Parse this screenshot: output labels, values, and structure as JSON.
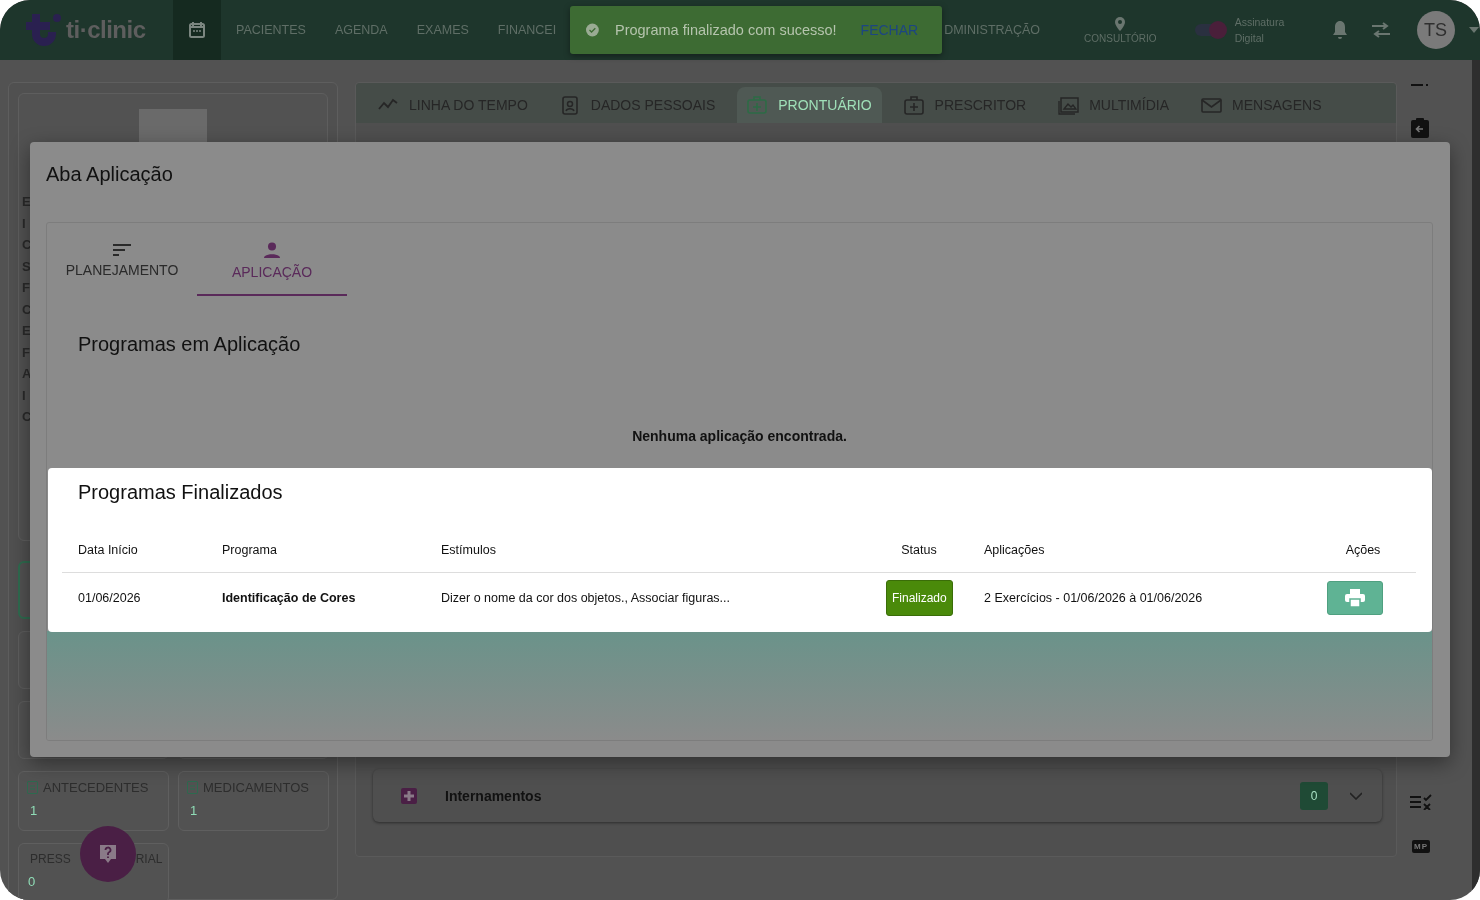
{
  "header": {
    "logo": "ti·clinic",
    "nav": [
      {
        "label": "PACIENTES"
      },
      {
        "label": "AGENDA"
      },
      {
        "label": "EXAMES"
      },
      {
        "label": "FINANCEI"
      },
      {
        "label": "DMINISTRAÇÃO"
      }
    ],
    "location_label": "CONSULTÓRIO",
    "signature_toggle": {
      "label": "Assinatura Digital",
      "on": true
    },
    "avatar_initials": "TS"
  },
  "toast": {
    "message": "Programa finalizado com sucesso!",
    "action": "FECHAR"
  },
  "patient_sidebar": {
    "info_fragments": [
      "E",
      "I",
      "C",
      "S",
      "F",
      "C",
      "E",
      "F",
      "A",
      "I",
      "C"
    ],
    "cards": [
      {
        "label_parts": [
          "ANTECEDENTES"
        ],
        "count": "1"
      },
      {
        "label_parts": [
          "MEDICAMENTOS"
        ],
        "count": "1"
      },
      {
        "label_parts": [
          "PRESS",
          "RIAL"
        ],
        "count": "0"
      }
    ]
  },
  "record_tabs": [
    {
      "label": "LINHA DO TEMPO",
      "selected": false
    },
    {
      "label": "DADOS PESSOAIS",
      "selected": false
    },
    {
      "label": "PRONTUÁRIO",
      "selected": true
    },
    {
      "label": "PRESCRITOR",
      "selected": false
    },
    {
      "label": "MULTIMÍDIA",
      "selected": false
    },
    {
      "label": "MENSAGENS",
      "selected": false
    }
  ],
  "record_sections": [
    {
      "title": "Internamentos",
      "count": "0",
      "expanded": false
    }
  ],
  "right_rail": {
    "badge": "MP"
  },
  "modal": {
    "title": "Aba Aplicação",
    "tabs": [
      {
        "label": "PLANEJAMENTO",
        "selected": false
      },
      {
        "label": "APLICAÇÃO",
        "selected": true
      }
    ],
    "active_section": {
      "title": "Programas em Aplicação",
      "empty_message": "Nenhuma aplicação encontrada."
    },
    "finished": {
      "title": "Programas Finalizados",
      "columns": [
        "Data Início",
        "Programa",
        "Estímulos",
        "Status",
        "Aplicações",
        "Ações"
      ],
      "rows": [
        {
          "start_date": "01/06/2026",
          "program": "Identificação de Cores",
          "stimuli": "Dizer o nome da cor dos objetos., Associar figuras...",
          "status": "Finalizado",
          "applications": "2 Exercícios - 01/06/2026 à 01/06/2026"
        }
      ]
    }
  }
}
